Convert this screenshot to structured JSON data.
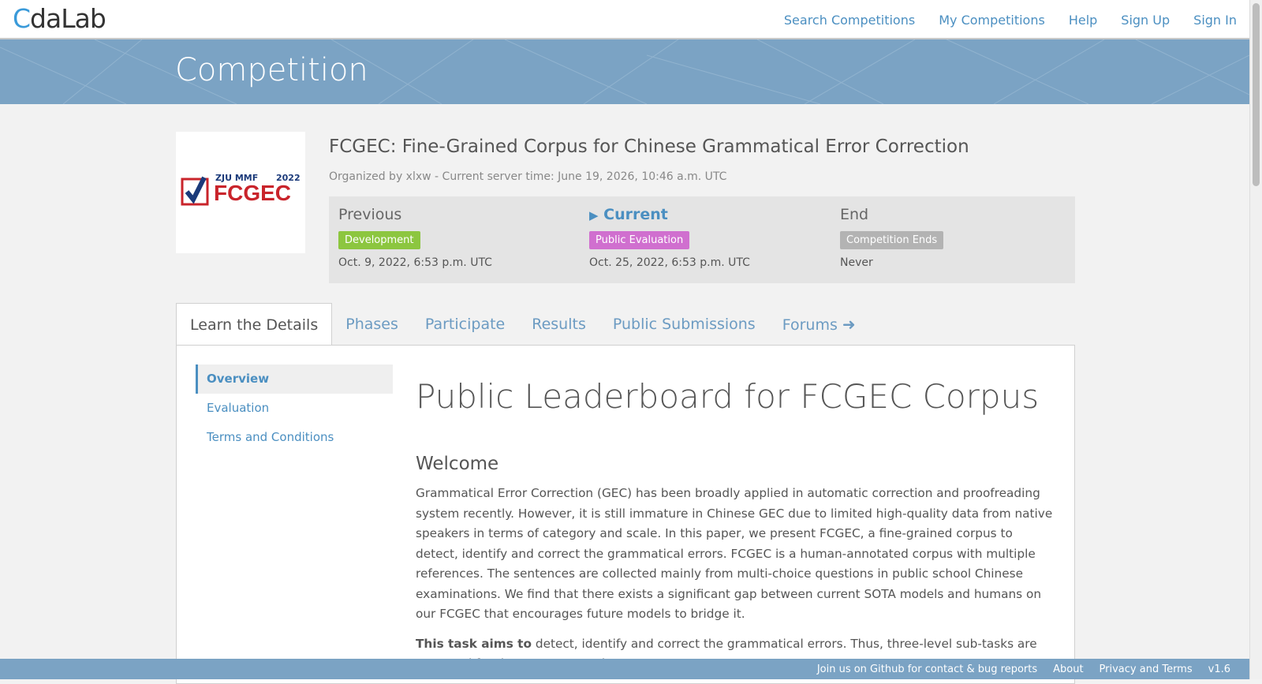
{
  "navbar": {
    "logo_prefix": "C",
    "logo_rest": "daLab",
    "links": [
      "Search Competitions",
      "My Competitions",
      "Help",
      "Sign Up",
      "Sign In"
    ]
  },
  "banner": {
    "title": "Competition"
  },
  "competition": {
    "logo_text_top": "ZJU MMF",
    "logo_year": "2022",
    "logo_name": "FCGEC",
    "title": "FCGEC: Fine-Grained Corpus for Chinese Grammatical Error Correction",
    "organized": "Organized by xlxw - Current server time: June 19, 2026, 10:46 a.m. UTC"
  },
  "phases": [
    {
      "label": "Previous",
      "badge": "Development",
      "badge_color": "#8cc63f",
      "date": "Oct. 9, 2022, 6:53 p.m. UTC"
    },
    {
      "label": "Current",
      "badge": "Public Evaluation",
      "badge_color": "#d06fcf",
      "date": "Oct. 25, 2022, 6:53 p.m. UTC"
    },
    {
      "label": "End",
      "badge": "Competition Ends",
      "badge_color": "#b3b3b3",
      "date": "Never"
    }
  ],
  "tabs": [
    "Learn the Details",
    "Phases",
    "Participate",
    "Results",
    "Public Submissions",
    "Forums"
  ],
  "side_nav": [
    "Overview",
    "Evaluation",
    "Terms and Conditions"
  ],
  "content": {
    "heading": "Public Leaderboard for FCGEC Corpus",
    "welcome": "Welcome",
    "paragraph": "Grammatical Error Correction (GEC) has been broadly applied in automatic correction and proofreading system recently. However, it is still immature in Chinese GEC due to limited high-quality data from native speakers in terms of category and scale. In this paper, we present FCGEC, a fine-grained corpus to detect, identify and correct the grammatical errors. FCGEC is a human-annotated corpus with multiple references. The sentences are collected mainly from multi-choice questions in public school Chinese examinations. We find that there exists a significant gap between current SOTA models and humans on our FCGEC that encourages future models to bridge it.",
    "task_bold": "This task aims to",
    "task_rest": " detect, identify and correct the grammatical errors. Thus, three-level sub-tasks are proposed for the GEC community."
  },
  "footer": {
    "github": "Join us on Github for contact & bug reports",
    "about": "About",
    "privacy": "Privacy and Terms",
    "version": "v1.6"
  },
  "colors": {
    "accent": "#4b8fc1",
    "banner": "#7ba3c4"
  }
}
